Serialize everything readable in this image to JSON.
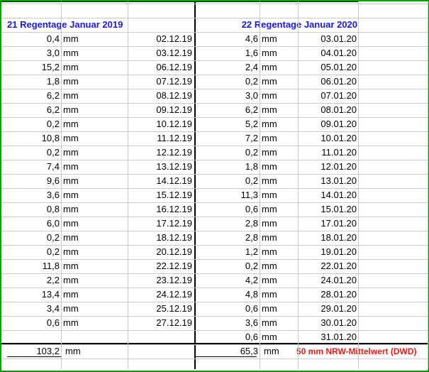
{
  "left_section": {
    "title": "21 Regentage Januar 2019",
    "rows": [
      {
        "amount": "0,4",
        "unit": "mm",
        "date": "02.12.19"
      },
      {
        "amount": "3,0",
        "unit": "mm",
        "date": "03.12.19"
      },
      {
        "amount": "15,2",
        "unit": "mm",
        "date": "06.12.19"
      },
      {
        "amount": "1,8",
        "unit": "mm",
        "date": "07.12.19"
      },
      {
        "amount": "6,2",
        "unit": "mm",
        "date": "08.12.19"
      },
      {
        "amount": "6,2",
        "unit": "mm",
        "date": "09.12.19"
      },
      {
        "amount": "0,2",
        "unit": "mm",
        "date": "10.12.19"
      },
      {
        "amount": "10,8",
        "unit": "mm",
        "date": "11.12.19"
      },
      {
        "amount": "0,2",
        "unit": "mm",
        "date": "12.12.19"
      },
      {
        "amount": "7,4",
        "unit": "mm",
        "date": "13.12.19"
      },
      {
        "amount": "9,6",
        "unit": "mm",
        "date": "14.12.19"
      },
      {
        "amount": "3,6",
        "unit": "mm",
        "date": "15.12.19"
      },
      {
        "amount": "0,8",
        "unit": "mm",
        "date": "16.12.19"
      },
      {
        "amount": "6,0",
        "unit": "mm",
        "date": "17.12.19"
      },
      {
        "amount": "0,2",
        "unit": "mm",
        "date": "18.12.19"
      },
      {
        "amount": "0,2",
        "unit": "mm",
        "date": "20.12.19"
      },
      {
        "amount": "11,8",
        "unit": "mm",
        "date": "22.12.19"
      },
      {
        "amount": "2,2",
        "unit": "mm",
        "date": "23.12.19"
      },
      {
        "amount": "13,4",
        "unit": "mm",
        "date": "24.12.19"
      },
      {
        "amount": "3,4",
        "unit": "mm",
        "date": "25.12.19"
      },
      {
        "amount": "0,6",
        "unit": "mm",
        "date": "27.12.19"
      }
    ],
    "total": "103,2",
    "total_unit": "mm"
  },
  "right_section": {
    "title": "22 Regentage Januar 2020",
    "rows": [
      {
        "amount": "4,6",
        "unit": "mm",
        "date": "03.01.20"
      },
      {
        "amount": "1,6",
        "unit": "mm",
        "date": "04.01.20"
      },
      {
        "amount": "2,4",
        "unit": "mm",
        "date": "05.01.20"
      },
      {
        "amount": "0,2",
        "unit": "mm",
        "date": "06.01.20"
      },
      {
        "amount": "3,0",
        "unit": "mm",
        "date": "07.01.20"
      },
      {
        "amount": "6,2",
        "unit": "mm",
        "date": "08.01.20"
      },
      {
        "amount": "5,2",
        "unit": "mm",
        "date": "09.01.20"
      },
      {
        "amount": "7,2",
        "unit": "mm",
        "date": "10.01.20"
      },
      {
        "amount": "0,2",
        "unit": "mm",
        "date": "11.01.20"
      },
      {
        "amount": "1,8",
        "unit": "mm",
        "date": "12.01.20"
      },
      {
        "amount": "0,2",
        "unit": "mm",
        "date": "13.01.20"
      },
      {
        "amount": "11,3",
        "unit": "mm",
        "date": "14.01.20"
      },
      {
        "amount": "0,6",
        "unit": "mm",
        "date": "15.01.20"
      },
      {
        "amount": "2,8",
        "unit": "mm",
        "date": "17.01.20"
      },
      {
        "amount": "2,8",
        "unit": "mm",
        "date": "18.01.20"
      },
      {
        "amount": "1,2",
        "unit": "mm",
        "date": "19.01.20"
      },
      {
        "amount": "0,2",
        "unit": "mm",
        "date": "22.01.20"
      },
      {
        "amount": "4,2",
        "unit": "mm",
        "date": "24.01.20"
      },
      {
        "amount": "4,8",
        "unit": "mm",
        "date": "28.01.20"
      },
      {
        "amount": "0,6",
        "unit": "mm",
        "date": "29.01.20"
      },
      {
        "amount": "3,6",
        "unit": "mm",
        "date": "30.01.20"
      },
      {
        "amount": "0,6",
        "unit": "mm",
        "date": "31.01.20"
      }
    ],
    "total": "65,3",
    "total_unit": "mm",
    "note": "50 mm NRW-Mittelwert (DWD)"
  },
  "colors": {
    "frame": "#00a000",
    "header": "#1a1adc",
    "note": "#e02020",
    "gridline": "#c8c8c8"
  }
}
